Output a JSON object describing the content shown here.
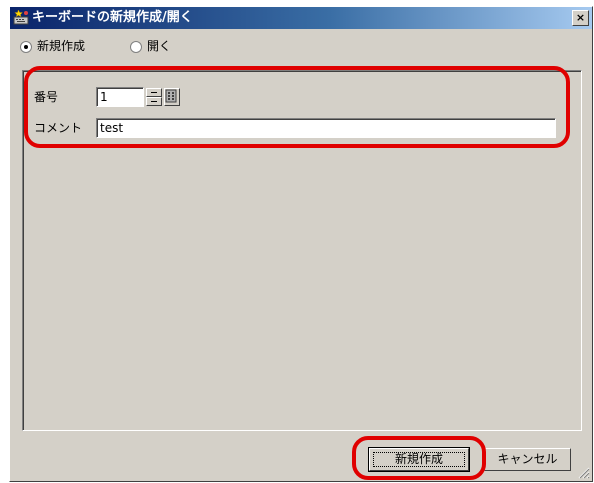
{
  "window": {
    "title": "キーボードの新規作成/開く",
    "close_label": "×"
  },
  "mode": {
    "options": [
      {
        "label": "新規作成",
        "selected": true
      },
      {
        "label": "開く",
        "selected": false
      }
    ]
  },
  "form": {
    "number_label": "番号",
    "number_value": "1",
    "comment_label": "コメント",
    "comment_value": "test"
  },
  "buttons": {
    "create_label": "新規作成",
    "cancel_label": "キャンセル"
  },
  "colors": {
    "highlight": "#e00000",
    "titlebar_start": "#0a246a",
    "face": "#d4d0c8"
  },
  "icons": {
    "title": "keyboard-app-icon",
    "spin_up": "spin-up-icon",
    "spin_down": "spin-down-icon",
    "keypad": "keypad-icon",
    "grip": "size-grip-icon"
  }
}
